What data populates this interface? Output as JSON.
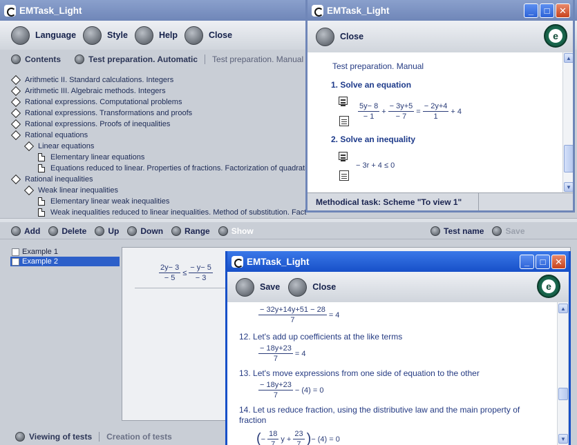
{
  "app_title": "EMTask_Light",
  "main": {
    "toolbar": [
      {
        "label": "Language"
      },
      {
        "label": "Style"
      },
      {
        "label": "Help"
      },
      {
        "label": "Close"
      }
    ],
    "tabs": [
      "Contents",
      "Test preparation. Automatic",
      "Test preparation. Manual"
    ],
    "tree": [
      {
        "label": "Arithmetic II. Standard calculations. Integers",
        "level": 0,
        "icon": "diamond"
      },
      {
        "label": "Arithmetic III. Algebraic methods. Integers",
        "level": 0,
        "icon": "diamond"
      },
      {
        "label": "Rational expressions. Computational problems",
        "level": 0,
        "icon": "diamond"
      },
      {
        "label": "Rational expressions. Transformations and proofs",
        "level": 0,
        "icon": "diamond"
      },
      {
        "label": "Rational expressions. Proofs of inequalities",
        "level": 0,
        "icon": "diamond"
      },
      {
        "label": "Rational equations",
        "level": 0,
        "icon": "diamond"
      },
      {
        "label": "Linear equations",
        "level": 1,
        "icon": "diamond"
      },
      {
        "label": "Elementary linear equations",
        "level": 2,
        "icon": "doc"
      },
      {
        "label": "Equations reduced to linear. Properties of fractions. Factorization of quadratic trinomial",
        "level": 2,
        "icon": "doc"
      },
      {
        "label": "Rational inequalities",
        "level": 0,
        "icon": "diamond"
      },
      {
        "label": "Weak linear inequalities",
        "level": 1,
        "icon": "diamond"
      },
      {
        "label": "Elementary linear weak inequalities",
        "level": 2,
        "icon": "doc"
      },
      {
        "label": "Weak inequalities reduced to linear inequalities. Method of substitution. Factorization of quadratic trinomial",
        "level": 2,
        "icon": "doc"
      }
    ],
    "actions": [
      "Add",
      "Delete",
      "Up",
      "Down",
      "Range",
      "Show"
    ],
    "right_actions": [
      "Test name",
      "Save"
    ],
    "examples": [
      {
        "label": "Example 1",
        "selected": false
      },
      {
        "label": "Example 2",
        "selected": true
      }
    ],
    "preview_expr": {
      "num1": "2y− 3",
      "den1": "− 5",
      "rel": "≤",
      "num2": "− y− 5",
      "den2": "− 3"
    },
    "bottom_tabs": [
      "Viewing of tests",
      "Creation of tests"
    ]
  },
  "win2": {
    "close_label": "Close",
    "heading": "Test preparation.  Manual",
    "task1": "1. Solve an equation",
    "eq1": {
      "a_num": "5y− 8",
      "a_den": "− 1",
      "op1": "+",
      "b_num": "− 3y+5",
      "b_den": "− 7",
      "eq": "=",
      "c_num": "− 2y+4",
      "c_den": "1",
      "tail": "+ 4"
    },
    "task2": "2. Solve an inequality",
    "ineq": "−  3r + 4 ≤ 0",
    "status": "Methodical task: Scheme \"To view 1\"",
    "logo": "e"
  },
  "win3": {
    "save_label": "Save",
    "close_label": "Close",
    "line0": {
      "num": "− 32y+14y+51 − 28",
      "den": "7",
      "tail": "= 4"
    },
    "step12": "12. Let's add up coefficients at the like terms",
    "line12": {
      "num": "− 18y+23",
      "den": "7",
      "tail": "= 4"
    },
    "step13": "13. Let's move expressions from one side of equation to the other",
    "line13": {
      "num": "− 18y+23",
      "den": "7",
      "tail": "− (4) = 0"
    },
    "step14": "14. Let us reduce fraction, using the distributive law and the main property of fraction",
    "line14": {
      "a": "18",
      "b": "23",
      "tail": "− (4) = 0"
    },
    "logo": "e"
  }
}
